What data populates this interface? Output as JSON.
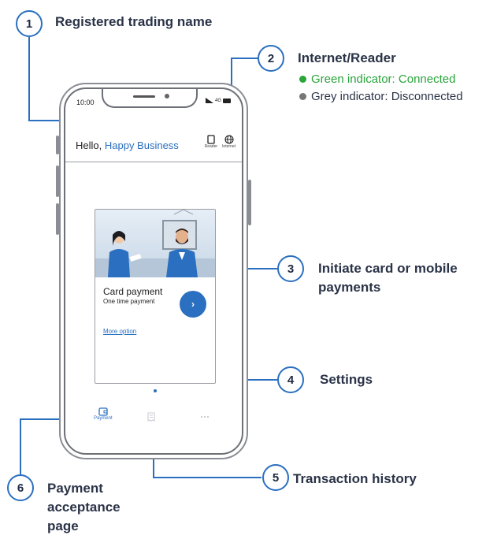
{
  "callouts": [
    {
      "num": "1",
      "label": "Registered trading name"
    },
    {
      "num": "2",
      "label": "Internet/Reader"
    },
    {
      "num": "3",
      "label": "Initiate card or mobile payments"
    },
    {
      "num": "4",
      "label": "Settings"
    },
    {
      "num": "5",
      "label": "Transaction history"
    },
    {
      "num": "6",
      "label": "Payment acceptance page"
    }
  ],
  "legend": {
    "connected": "Green indicator: Connected",
    "disconnected": "Grey indicator: Disconnected",
    "connected_color": "#2aa43b",
    "disconnected_color": "#777777"
  },
  "phone": {
    "status_time": "10:00",
    "status_network": "4G",
    "greeting_prefix": "Hello, ",
    "business_name": "Happy Business",
    "reader_label": "Reader",
    "internet_label": "Internet",
    "card_title": "Card payment",
    "card_subtitle": "One time payment",
    "card_link": "More option",
    "nav_payment": "Payment",
    "reader_icon": "card-reader-icon",
    "internet_icon": "globe-icon",
    "payment_nav_icon": "wallet-icon",
    "history_nav_icon": "receipt-icon",
    "settings_nav_icon": "more-dots-icon"
  },
  "colors": {
    "accent": "#2a6fc0",
    "text": "#2a3347"
  }
}
